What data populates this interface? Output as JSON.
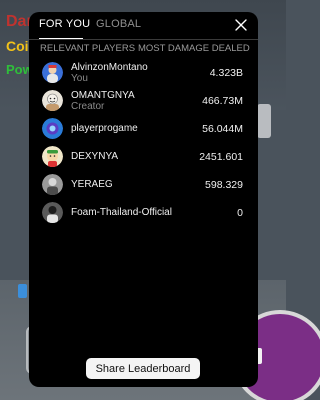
{
  "hud": {
    "damage_label": "Damage",
    "coins_label": "Coins:",
    "power_label": "Power"
  },
  "tabs": [
    {
      "label": "FOR YOU",
      "active": true
    },
    {
      "label": "GLOBAL",
      "active": false
    }
  ],
  "subheader": {
    "left": "RELEVANT PLAYERS",
    "right": "MOST DAMAGE DEALED"
  },
  "players": [
    {
      "name": "AlvinzonMontano",
      "sub": "You",
      "value": "4.323B",
      "avatar_color": "#3a6fd8",
      "avatar_icon": "avatar-blue-icon"
    },
    {
      "name": "OMANTGNYA",
      "sub": "Creator",
      "value": "466.73M",
      "avatar_color": "#e9e4da",
      "avatar_icon": "avatar-face-icon"
    },
    {
      "name": "playerprogame",
      "sub": "",
      "value": "56.044M",
      "avatar_color": "#2a7bd8",
      "avatar_icon": "avatar-swirl-icon"
    },
    {
      "name": "DEXYNYA",
      "sub": "",
      "value": "2451.601",
      "avatar_color": "#efe6c8",
      "avatar_icon": "avatar-cartoon-icon"
    },
    {
      "name": "YERAEG",
      "sub": "",
      "value": "598.329",
      "avatar_color": "#9a9a9a",
      "avatar_icon": "avatar-gray-icon"
    },
    {
      "name": "Foam-Thailand-Official",
      "sub": "",
      "value": "0",
      "avatar_color": "#5a5a5a",
      "avatar_icon": "avatar-dark-icon"
    }
  ],
  "share_button": "Share Leaderboard",
  "colors": {
    "modal_bg": "#000000",
    "active_tab": "#ffffff",
    "inactive_tab": "#8f8f8f"
  }
}
